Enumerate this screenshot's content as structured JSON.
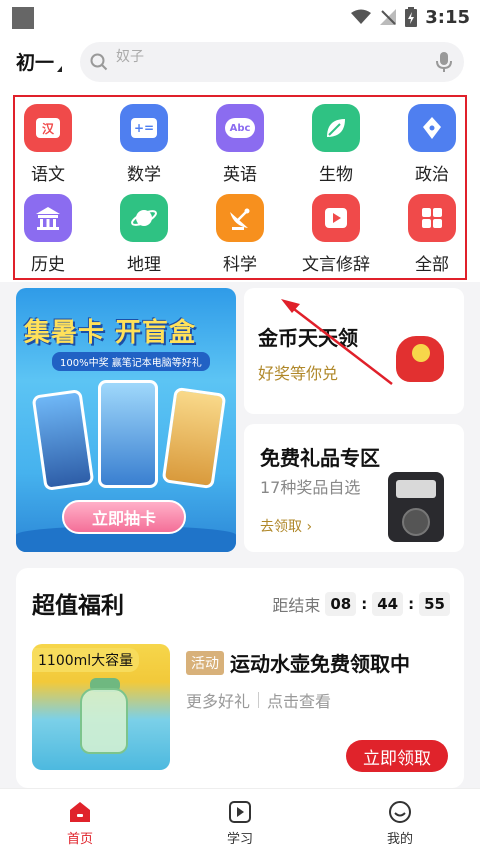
{
  "status_bar": {
    "time": "3:15"
  },
  "header": {
    "grade": "初一",
    "search_placeholder": "奴子"
  },
  "subjects": [
    {
      "label": "语文",
      "icon": "chinese-icon",
      "glyph": "汉",
      "color": "#f04a4a"
    },
    {
      "label": "数学",
      "icon": "math-icon",
      "glyph": "+=",
      "color": "#4f7ff0"
    },
    {
      "label": "英语",
      "icon": "english-icon",
      "glyph": "Abc",
      "color": "#8b6cf0"
    },
    {
      "label": "生物",
      "icon": "biology-icon",
      "glyph": "",
      "color": "#2fc283"
    },
    {
      "label": "政治",
      "icon": "politics-icon",
      "glyph": "",
      "color": "#4f7ff0"
    },
    {
      "label": "历史",
      "icon": "history-icon",
      "glyph": "",
      "color": "#8b6cf0"
    },
    {
      "label": "地理",
      "icon": "geography-icon",
      "glyph": "",
      "color": "#2fc283"
    },
    {
      "label": "科学",
      "icon": "science-icon",
      "glyph": "",
      "color": "#f7901e"
    },
    {
      "label": "文言修辞",
      "icon": "classical-chinese-icon",
      "glyph": "",
      "color": "#f04a4a"
    },
    {
      "label": "全部",
      "icon": "all-icon",
      "glyph": "",
      "color": "#f04a4a"
    }
  ],
  "banner": {
    "title": "集暑卡 开盲盒",
    "subtitle": "100%中奖 赢笔记本电脑等好礼",
    "button": "立即抽卡"
  },
  "coin_card": {
    "title": "金币天天领",
    "subtitle": "好奖等你兑"
  },
  "gift_card": {
    "title": "免费礼品专区",
    "subtitle": "17种奖品自选",
    "link": "去领取 ›"
  },
  "welfare": {
    "title": "超值福利",
    "countdown_label": "距结束",
    "hours": "08",
    "minutes": "44",
    "seconds": "55",
    "product": {
      "tag": "1100ml大容量",
      "badge": "活动",
      "name": "运动水壶免费领取中",
      "more": "更多好礼",
      "view": "点击查看",
      "button": "立即领取"
    }
  },
  "tabbar": {
    "home": "首页",
    "study": "学习",
    "mine": "我的"
  }
}
